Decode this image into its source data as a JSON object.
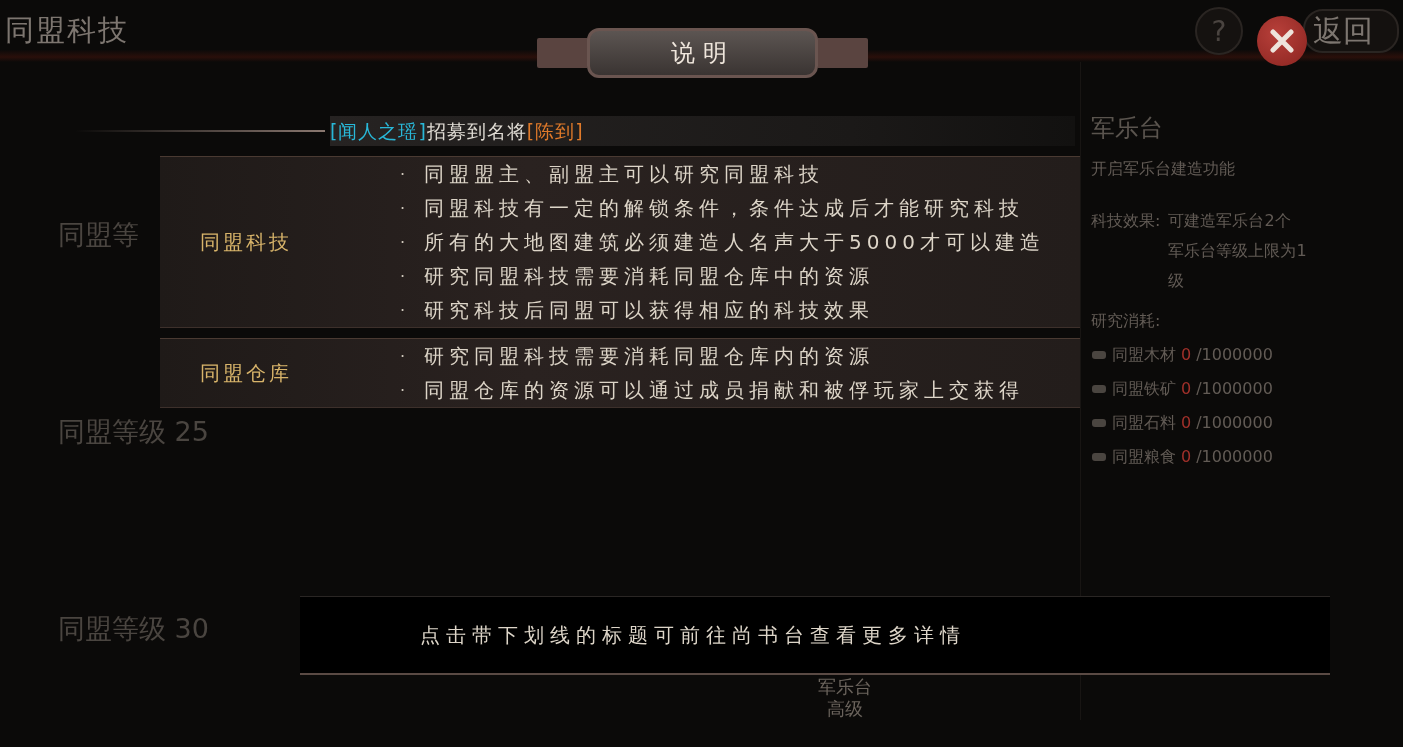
{
  "header": {
    "title": "同盟科技",
    "help": "?",
    "back": "返回"
  },
  "levels": [
    "同盟等",
    "同盟等级 25",
    "同盟等级 30"
  ],
  "building": {
    "name": "军乐台",
    "tier": "高级"
  },
  "side_panel": {
    "title": "军乐台",
    "unlock": "开启军乐台建造功能",
    "effect_label": "科技效果:",
    "effect_lines": [
      "可建造军乐台2个",
      "军乐台等级上限为1",
      "级"
    ],
    "cost_label": "研究消耗:",
    "costs": [
      {
        "name": "同盟木材",
        "amount": "0",
        "limit": "/1000000"
      },
      {
        "name": "同盟铁矿",
        "amount": "0",
        "limit": "/1000000"
      },
      {
        "name": "同盟石料",
        "amount": "0",
        "limit": "/1000000"
      },
      {
        "name": "同盟粮食",
        "amount": "0",
        "limit": "/1000000"
      }
    ]
  },
  "dialog": {
    "title": "说明",
    "announcement": [
      {
        "text": "[闻人之瑶]",
        "color": "#29b8d8"
      },
      {
        "text": "招募到名将",
        "color": "#e0dcd4"
      },
      {
        "text": "[陈到]",
        "color": "#e07a2a"
      }
    ],
    "sections": [
      {
        "label": "同盟科技",
        "items": [
          {
            "bullet": "·",
            "text": "同盟盟主、副盟主可以研究同盟科技"
          },
          {
            "bullet": "·",
            "text": "同盟科技有一定的解锁条件，条件达成后才能研究科技"
          },
          {
            "bullet": "·",
            "text": "所有的大地图建筑必须建造人名声大于5000才可以建造"
          },
          {
            "bullet": "·",
            "text": "研究同盟科技需要消耗同盟仓库中的资源"
          },
          {
            "bullet": "·",
            "text": "研究科技后同盟可以获得相应的科技效果"
          }
        ]
      },
      {
        "label": "同盟仓库",
        "items": [
          {
            "bullet": "·",
            "text": "研究同盟科技需要消耗同盟仓库内的资源"
          },
          {
            "bullet": "·",
            "text": "同盟仓库的资源可以通过成员捐献和被俘玩家上交获得"
          }
        ]
      }
    ],
    "footer": "点击带下划线的标题可前往尚书台查看更多详情"
  }
}
